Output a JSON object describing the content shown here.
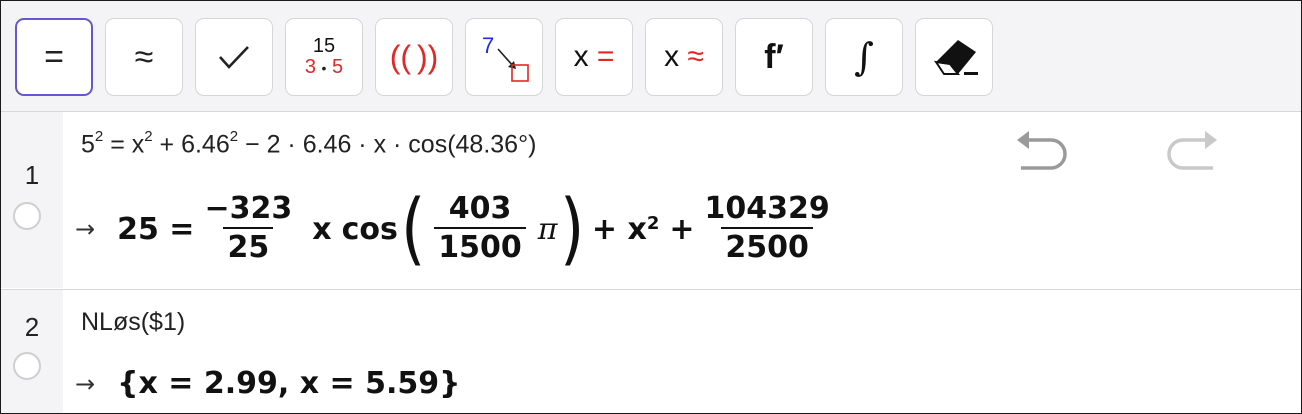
{
  "toolbar": {
    "buttons": [
      {
        "id": "evaluate",
        "label": "="
      },
      {
        "id": "numeric",
        "label": "≈"
      },
      {
        "id": "keep-input",
        "label": "✓"
      },
      {
        "id": "factor",
        "top": "15",
        "bottom_left": "3",
        "dot": "•",
        "bottom_right": "5"
      },
      {
        "id": "expand",
        "label_open": "((",
        "label_close": "))"
      },
      {
        "id": "substitute",
        "label": "7"
      },
      {
        "id": "solve",
        "x": "x",
        "op": "="
      },
      {
        "id": "solve-numerically",
        "x": "x",
        "op": "≈"
      },
      {
        "id": "derivative",
        "label": "f′"
      },
      {
        "id": "integral",
        "label": "∫"
      },
      {
        "id": "delete",
        "label": ""
      }
    ]
  },
  "rows": [
    {
      "number": "1",
      "input": {
        "base": "5",
        "exp1": "2",
        "eq": " = x",
        "exp2": "2",
        "mid": " + 6.46",
        "exp3": "2",
        "tail": " − 2 · 6.46 · x · cos(48.36°)"
      },
      "output": {
        "arrow": "→",
        "lhs": "25 =",
        "frac1_num": "−323",
        "frac1_den": "25",
        "x": "x",
        "cos": "cos",
        "frac2_num": "403",
        "frac2_den": "1500",
        "pi": "π",
        "plus_x": "+ x",
        "x_exp": "2",
        "plus": "+",
        "frac3_num": "104329",
        "frac3_den": "2500"
      }
    },
    {
      "number": "2",
      "input_text": "NLøs($1)",
      "output": {
        "arrow": "→",
        "text": "{x = 2.99, x = 5.59}"
      }
    }
  ]
}
